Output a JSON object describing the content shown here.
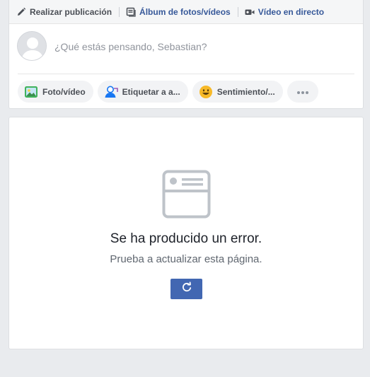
{
  "composer": {
    "tabs": [
      {
        "label": "Realizar publicación",
        "icon": "pencil-icon"
      },
      {
        "label": "Álbum de fotos/vídeos",
        "icon": "photo-album-icon"
      },
      {
        "label": "Vídeo en directo",
        "icon": "video-camera-icon"
      }
    ],
    "placeholder": "¿Qué estás pensando, Sebastian?",
    "actions": [
      {
        "label": "Foto/vídeo",
        "icon": "photo-icon"
      },
      {
        "label": "Etiquetar a a...",
        "icon": "tag-person-icon"
      },
      {
        "label": "Sentimiento/...",
        "icon": "emoji-icon"
      },
      {
        "label": "",
        "icon": "more-icon"
      }
    ]
  },
  "error": {
    "title": "Se ha producido un error.",
    "subtitle": "Prueba a actualizar esta página.",
    "reload_icon": "refresh-icon"
  },
  "colors": {
    "brand_blue": "#4267b2",
    "link_blue": "#365899",
    "page_bg": "#e9ebee"
  }
}
